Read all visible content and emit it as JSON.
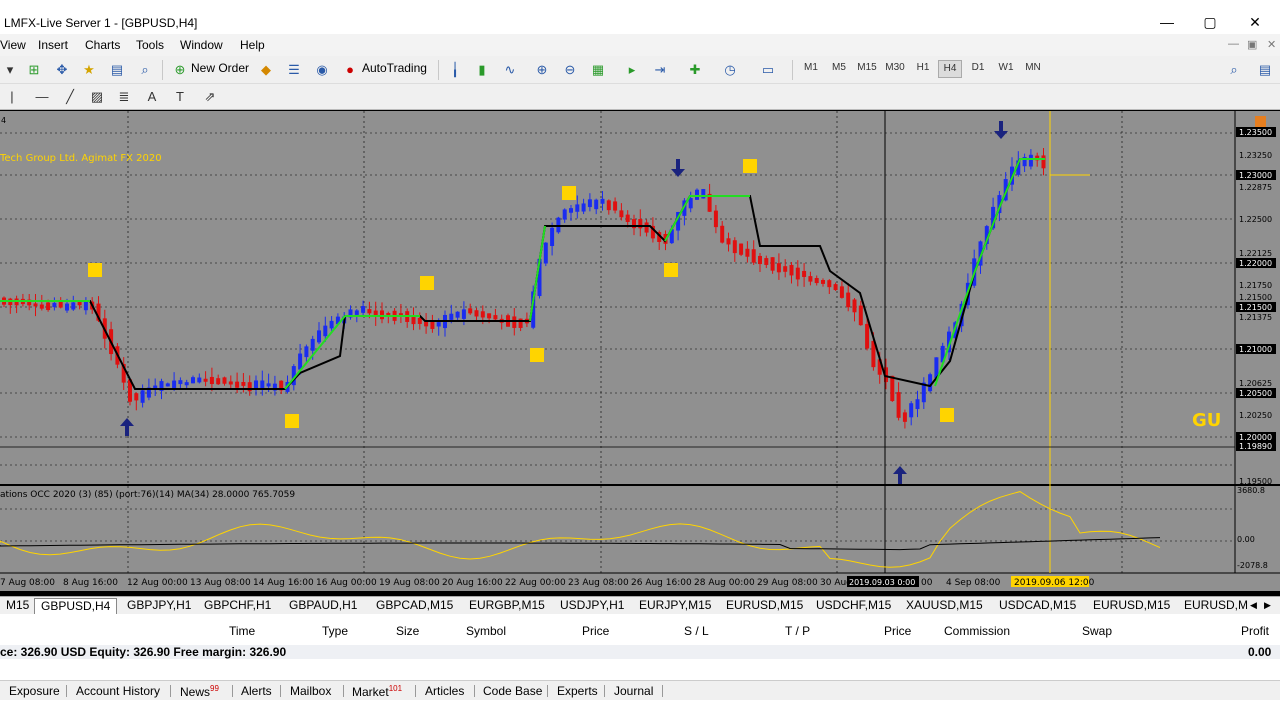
{
  "window": {
    "title": "LMFX-Live Server 1 - [GBPUSD,H4]",
    "min": "—",
    "max": "▢",
    "close": "✕"
  },
  "menu": [
    "View",
    "Insert",
    "Charts",
    "Tools",
    "Window",
    "Help"
  ],
  "toolbar": {
    "new_order": "New Order",
    "autotrading": "AutoTrading",
    "timeframes": [
      "M1",
      "M5",
      "M15",
      "M30",
      "H1",
      "H4",
      "D1",
      "W1",
      "MN"
    ],
    "active_tf": "H4"
  },
  "chart": {
    "corner_label": "4",
    "watermark": "Tech Group Ltd. Agimat FX 2020",
    "symbol_tag": "GU",
    "indicator_label": "ations OCC 2020 (3) (85) (port:76)(14) MA(34) 28.0000 765.7059",
    "price_ticks": [
      "1.23250",
      "1.23000",
      "1.22875",
      "1.22500",
      "1.22125",
      "1.22000",
      "1.21750",
      "1.21500",
      "1.21375",
      "1.21000",
      "1.20625",
      "1.20500",
      "1.20250",
      "1.20000",
      "1.19890",
      "1.19500"
    ],
    "boxed_prices": [
      "1.23500",
      "1.23000",
      "1.22000",
      "1.21500",
      "1.21000",
      "1.20500",
      "1.20000",
      "1.19890"
    ],
    "indicator_ticks": [
      "3680.8",
      "0.00",
      "-2078.8"
    ],
    "dates": [
      "7 Aug 08:00",
      "8 Aug 16:00",
      "12 Aug 00:00",
      "13 Aug 08:00",
      "14 Aug 16:00",
      "16 Aug 00:00",
      "19 Aug 08:00",
      "20 Aug 16:00",
      "22 Aug 00:00",
      "23 Aug 08:00",
      "26 Aug 16:00",
      "28 Aug 00:00",
      "29 Aug 08:00",
      "30 Aug"
    ],
    "crosshair_date": "2019.09.03 0:00",
    "crosshair_date_tail": "00",
    "sep_date": "4 Sep 08:00",
    "vline_date": "2019.09.06 12:00",
    "colors": {
      "bull": "#1a2cf0",
      "bear": "#e01010",
      "bg": "#909090",
      "signal": "#ffd400",
      "arrow": "#1a237e"
    }
  },
  "tabs": [
    "M15",
    "GBPUSD,H4",
    "GBPJPY,H1",
    "GBPCHF,H1",
    "GBPAUD,H1",
    "GBPCAD,M15",
    "EURGBP,M15",
    "USDJPY,H1",
    "EURJPY,M15",
    "EURUSD,M15",
    "USDCHF,M15",
    "XAUUSD,M15",
    "USDCAD,M15",
    "EURUSD,M15",
    "EURUSD,M"
  ],
  "terminal": {
    "headers": [
      "Time",
      "Type",
      "Size",
      "Symbol",
      "Price",
      "S / L",
      "T / P",
      "Price",
      "Commission",
      "Swap",
      "Profit"
    ],
    "balance": "ce: 326.90 USD  Equity: 326.90  Free margin: 326.90",
    "profit": "0.00",
    "bottom_tabs": [
      {
        "label": "Exposure",
        "badge": ""
      },
      {
        "label": "Account History",
        "badge": ""
      },
      {
        "label": "News",
        "badge": "99"
      },
      {
        "label": "Alerts",
        "badge": ""
      },
      {
        "label": "Mailbox",
        "badge": ""
      },
      {
        "label": "Market",
        "badge": "101"
      },
      {
        "label": "Articles",
        "badge": ""
      },
      {
        "label": "Code Base",
        "badge": ""
      },
      {
        "label": "Experts",
        "badge": ""
      },
      {
        "label": "Journal",
        "badge": ""
      }
    ]
  }
}
